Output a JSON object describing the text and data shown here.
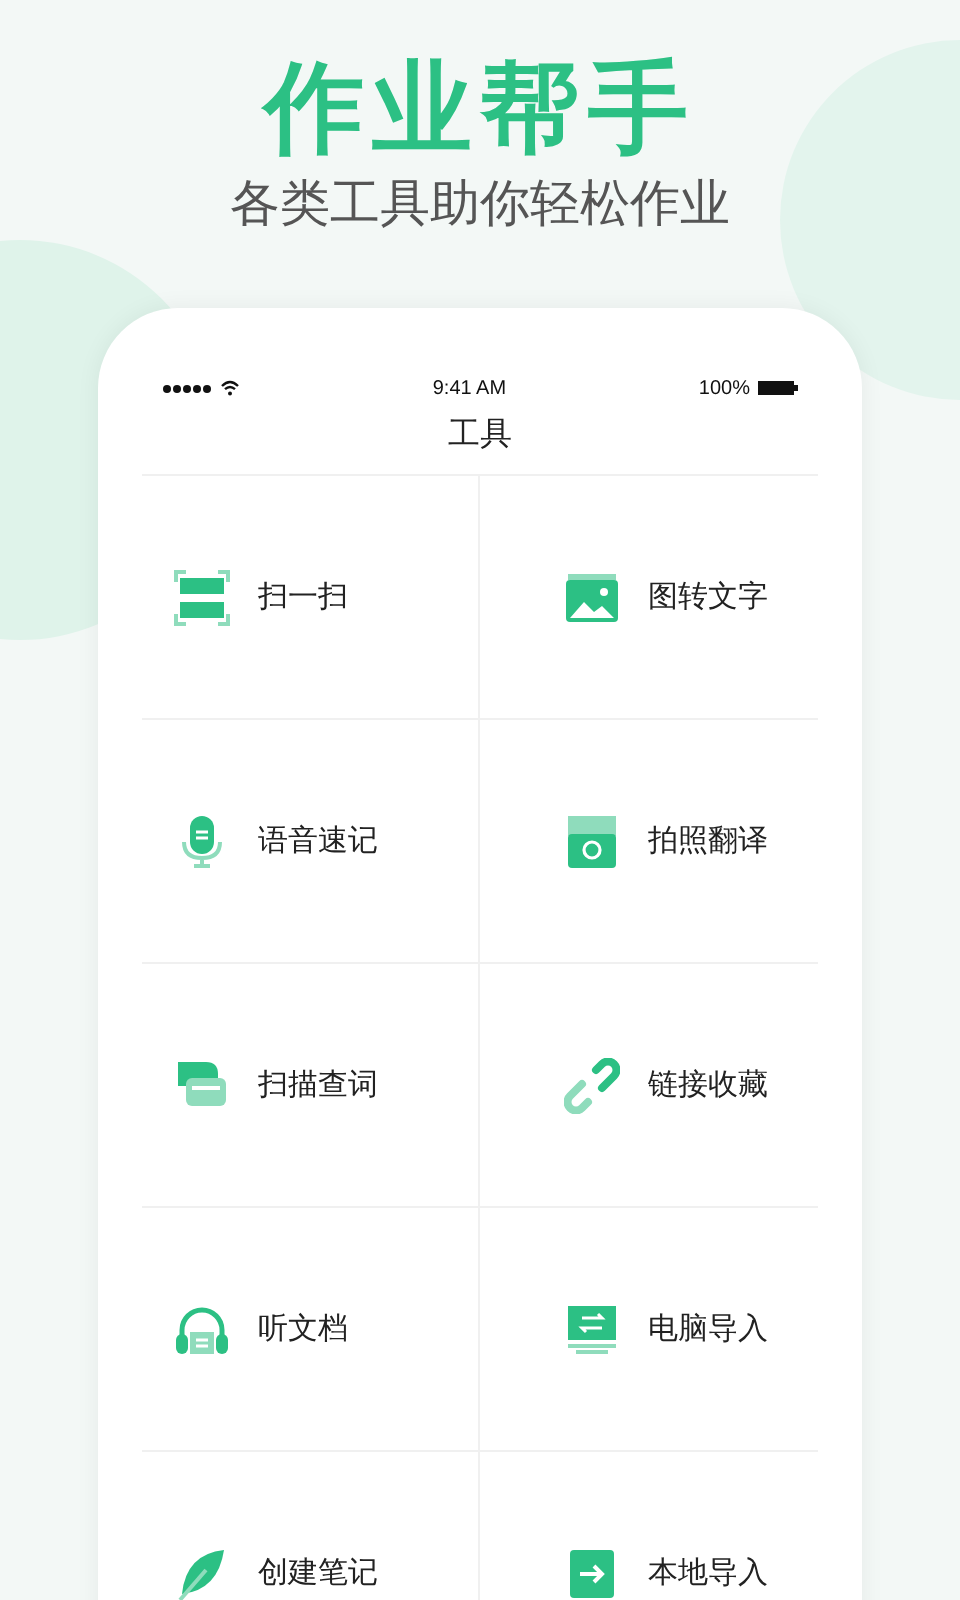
{
  "headline": "作业帮手",
  "subtitle": "各类工具助你轻松作业",
  "status_bar": {
    "time": "9:41 AM",
    "battery": "100%"
  },
  "screen_title": "工具",
  "tools": [
    {
      "label": "扫一扫"
    },
    {
      "label": "图转文字"
    },
    {
      "label": "语音速记"
    },
    {
      "label": "拍照翻译"
    },
    {
      "label": "扫描查词"
    },
    {
      "label": "链接收藏"
    },
    {
      "label": "听文档"
    },
    {
      "label": "电脑导入"
    },
    {
      "label": "创建笔记"
    },
    {
      "label": "本地导入"
    }
  ]
}
